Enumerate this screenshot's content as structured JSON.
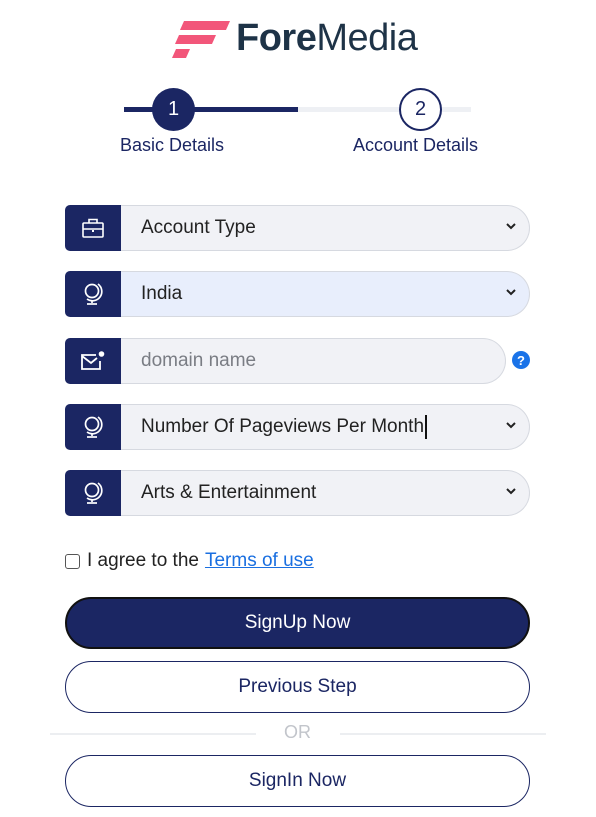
{
  "brand": {
    "name_bold": "Fore",
    "name_regular": "Media",
    "logo_icon": "foremedia-f-logo",
    "colors": {
      "accent": "#f2567a",
      "text": "#1e3347"
    }
  },
  "stepper": {
    "steps": [
      {
        "number": "1",
        "label": "Basic Details",
        "state": "active"
      },
      {
        "number": "2",
        "label": "Account Details",
        "state": "pending"
      }
    ],
    "colors": {
      "active": "#1b2663",
      "inactive": "#eef0f4"
    }
  },
  "form": {
    "account_type": {
      "icon": "briefcase-icon",
      "selected": "Account Type"
    },
    "country": {
      "icon": "globe-icon",
      "selected": "India"
    },
    "domain": {
      "icon": "mail-notification-icon",
      "placeholder": "domain name",
      "value": "",
      "help_icon": "question-circle-icon",
      "help_glyph": "?"
    },
    "pageviews": {
      "icon": "globe-icon",
      "selected": "Number Of Pageviews Per Month"
    },
    "category": {
      "icon": "globe-icon",
      "selected": "Arts & Entertainment"
    }
  },
  "agreement": {
    "checked": false,
    "text": "I agree to the",
    "link_text": "Terms of use"
  },
  "buttons": {
    "signup": "SignUp Now",
    "previous": "Previous Step",
    "divider_text": "OR",
    "signin": "SignIn Now"
  }
}
